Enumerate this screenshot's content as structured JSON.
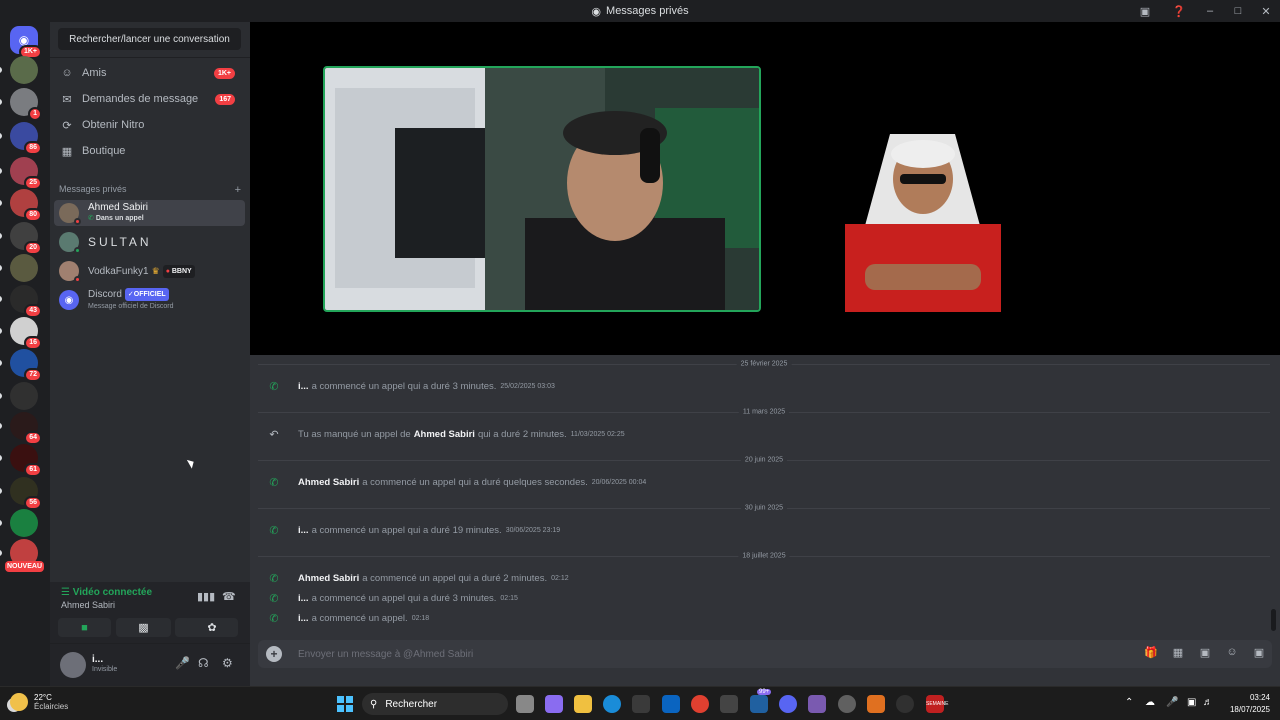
{
  "window": {
    "title": "Messages privés",
    "discord_icon": "discord-icon"
  },
  "rail": {
    "home_badge": "1K+",
    "servers": [
      {
        "badge": "",
        "color": "#5a6b4a"
      },
      {
        "badge": "1",
        "color": "#7a7c80"
      },
      {
        "badge": "86",
        "color": "#3a4aa0"
      },
      {
        "badge": "25",
        "color": "#a04050"
      },
      {
        "badge": "80",
        "color": "#b04040"
      },
      {
        "badge": "20",
        "color": "#404040"
      },
      {
        "badge": "",
        "color": "#5a5a40"
      },
      {
        "badge": "43",
        "color": "#2a2a2a"
      },
      {
        "badge": "16",
        "color": "#d0d0d0"
      },
      {
        "badge": "72",
        "color": "#2050a0"
      },
      {
        "badge": "",
        "color": "#303030"
      },
      {
        "badge": "64",
        "color": "#2a1a1a"
      },
      {
        "badge": "61",
        "color": "#3a1010"
      },
      {
        "badge": "56",
        "color": "#303020"
      },
      {
        "badge": "",
        "color": "#1a8040"
      },
      {
        "badge": "",
        "color": "#c04040"
      }
    ],
    "new_label": "NOUVEAU"
  },
  "sidebar": {
    "search_label": "Rechercher/lancer une conversation",
    "nav": [
      {
        "label": "Amis",
        "count": "1K+",
        "icon": "friends-icon"
      },
      {
        "label": "Demandes de message",
        "count": "167",
        "icon": "mail-icon"
      },
      {
        "label": "Obtenir Nitro",
        "count": "",
        "icon": "nitro-icon"
      },
      {
        "label": "Boutique",
        "count": "",
        "icon": "shop-icon"
      }
    ],
    "dm_header": "Messages privés",
    "dm_add": "+",
    "dms": [
      {
        "name": "Ahmed Sabiri",
        "sub": "Dans un appel",
        "color": "#7a6a5a"
      },
      {
        "name": "SULTAN",
        "sub": "",
        "color": "#5a7a70"
      },
      {
        "name": "VodkaFunky1",
        "tag": "BBNY",
        "sub": "",
        "color": "#a08070"
      },
      {
        "name": "Discord",
        "official": "OFFICIEL",
        "sub": "Message officiel de Discord",
        "color": "#5865f2"
      }
    ]
  },
  "voice": {
    "status": "Vidéo connectée",
    "user": "Ahmed Sabiri"
  },
  "user": {
    "name": "i...",
    "status": "Invisible"
  },
  "history": {
    "dates": [
      "25 février 2025",
      "11 mars 2025",
      "20 juin 2025",
      "30 juin 2025",
      "18 juillet 2025"
    ],
    "messages": [
      {
        "who": "i...",
        "text": "a commencé un appel qui a duré 3 minutes.",
        "ts": "25/02/2025 03:03"
      },
      {
        "pre": "Tu as manqué un appel de",
        "who": "Ahmed Sabiri",
        "text": "qui a duré 2 minutes.",
        "ts": "11/03/2025 02:25"
      },
      {
        "who": "Ahmed Sabiri",
        "text": "a commencé un appel qui a duré quelques secondes.",
        "ts": "20/06/2025 00:04"
      },
      {
        "who": "i...",
        "text": "a commencé un appel qui a duré 19 minutes.",
        "ts": "30/06/2025 23:19"
      },
      {
        "who": "Ahmed Sabiri",
        "text": "a commencé un appel qui a duré 2 minutes.",
        "ts": "02:12"
      },
      {
        "who": "i...",
        "text": "a commencé un appel qui a duré 3 minutes.",
        "ts": "02:15"
      },
      {
        "who": "i...",
        "text": "a commencé un appel.",
        "ts": "02:18"
      }
    ]
  },
  "composer": {
    "placeholder": "Envoyer un message à @Ahmed Sabiri"
  },
  "taskbar": {
    "temp": "22°C",
    "weather": "Éclaircies",
    "search": "Rechercher",
    "badge": "99+",
    "time": "03:24",
    "date": "18/07/2025",
    "mail_label": "SEMAINE"
  },
  "colors": {
    "accent": "#5865f2",
    "green": "#23a55a",
    "red": "#f23f43"
  }
}
